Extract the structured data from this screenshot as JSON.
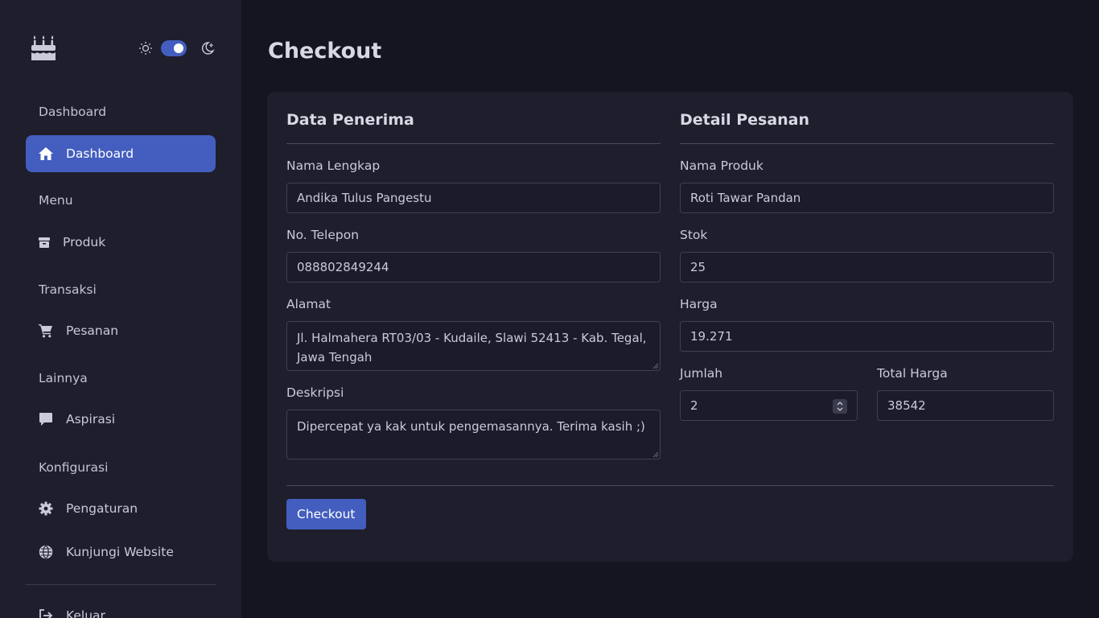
{
  "theme": {
    "accent": "#435ebe",
    "background": "#151521",
    "surface": "#1e1e2d"
  },
  "sidebar": {
    "logo_icon": "cake-icon",
    "theme_toggle": {
      "light_icon": "sun-icon",
      "dark_icon": "moon-icon",
      "state": "dark"
    },
    "sections": [
      {
        "title": "Dashboard",
        "items": [
          {
            "label": "Dashboard",
            "icon": "house-icon",
            "active": true
          }
        ]
      },
      {
        "title": "Menu",
        "items": [
          {
            "label": "Produk",
            "icon": "box-icon"
          }
        ]
      },
      {
        "title": "Transaksi",
        "items": [
          {
            "label": "Pesanan",
            "icon": "cart-icon"
          }
        ]
      },
      {
        "title": "Lainnya",
        "items": [
          {
            "label": "Aspirasi",
            "icon": "chat-icon"
          }
        ]
      },
      {
        "title": "Konfigurasi",
        "items": [
          {
            "label": "Pengaturan",
            "icon": "gear-icon"
          },
          {
            "label": "Kunjungi Website",
            "icon": "globe-icon"
          }
        ]
      }
    ],
    "logout": {
      "label": "Keluar",
      "icon": "logout-icon"
    }
  },
  "page": {
    "title": "Checkout"
  },
  "recipient": {
    "title": "Data Penerima",
    "name_label": "Nama Lengkap",
    "name_value": "Andika Tulus Pangestu",
    "phone_label": "No. Telepon",
    "phone_value": "088802849244",
    "address_label": "Alamat",
    "address_value": "Jl. Halmahera RT03/03 - Kudaile, Slawi 52413 - Kab. Tegal, Jawa Tengah",
    "description_label": "Deskripsi",
    "description_value": "Dipercepat ya kak untuk pengemasannya. Terima kasih ;)"
  },
  "order": {
    "title": "Detail Pesanan",
    "product_label": "Nama Produk",
    "product_value": "Roti Tawar Pandan",
    "stock_label": "Stok",
    "stock_value": "25",
    "price_label": "Harga",
    "price_value": "19.271",
    "quantity_label": "Jumlah",
    "quantity_value": "2",
    "total_label": "Total Harga",
    "total_value": "38542"
  },
  "actions": {
    "checkout_label": "Checkout"
  }
}
